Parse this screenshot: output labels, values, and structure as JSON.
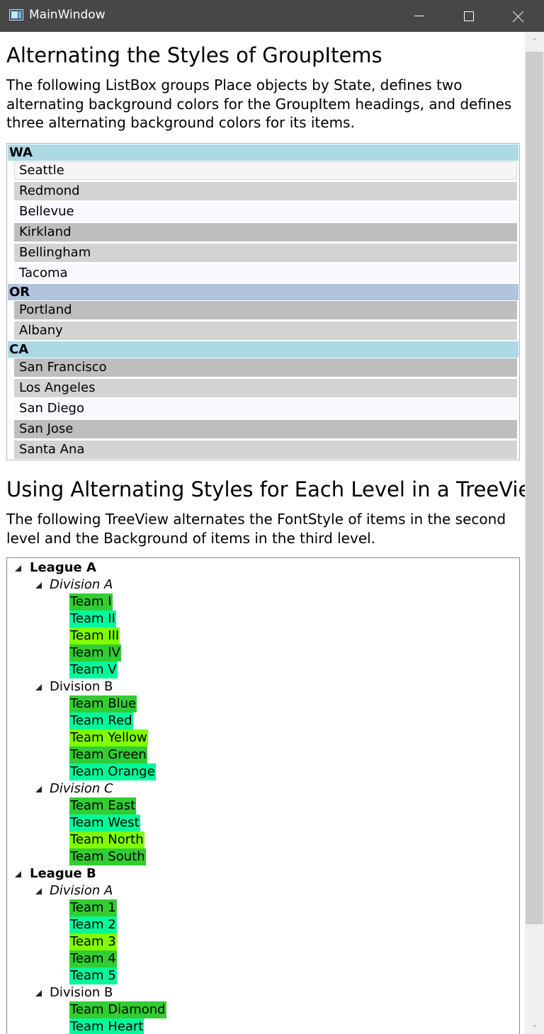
{
  "window": {
    "title": "MainWindow"
  },
  "section1": {
    "heading": "Alternating the Styles of GroupItems",
    "paragraph": "The following ListBox groups Place objects by State, defines two alternating background colors for the GroupItem headings, and defines three alternating background colors for its items."
  },
  "listbox": {
    "groups": [
      {
        "state": "WA",
        "color": "#ADD8E6",
        "items": [
          {
            "name": "Seattle",
            "color": "#F5F5F5",
            "selected": true
          },
          {
            "name": "Redmond",
            "color": "#D3D3D3"
          },
          {
            "name": "Bellevue",
            "color": "#F8F8FF"
          },
          {
            "name": "Kirkland",
            "color": "#BEBEBE"
          },
          {
            "name": "Bellingham",
            "color": "#D3D3D3"
          },
          {
            "name": "Tacoma",
            "color": "#F8F8FF"
          }
        ]
      },
      {
        "state": "OR",
        "color": "#B0C4DE",
        "items": [
          {
            "name": "Portland",
            "color": "#BEBEBE"
          },
          {
            "name": "Albany",
            "color": "#D3D3D3"
          }
        ]
      },
      {
        "state": "CA",
        "color": "#ADD8E6",
        "items": [
          {
            "name": "San Francisco",
            "color": "#BEBEBE"
          },
          {
            "name": "Los Angeles",
            "color": "#D3D3D3"
          },
          {
            "name": "San Diego",
            "color": "#F8F8FF"
          },
          {
            "name": "San Jose",
            "color": "#BEBEBE"
          },
          {
            "name": "Santa Ana",
            "color": "#D3D3D3"
          }
        ]
      }
    ]
  },
  "section2": {
    "heading": "Using Alternating Styles for Each Level in a TreeView",
    "paragraph": "The following TreeView alternates the FontStyle of items in the second level and the Background of items in the third level."
  },
  "treeview": {
    "team_colors": [
      "#32CD32",
      "#00FA9A",
      "#7FFF00"
    ],
    "leagues": [
      {
        "name": "League A",
        "divisions": [
          {
            "name": "Division A",
            "teams": [
              "Team I",
              "Team II",
              "Team III",
              "Team IV",
              "Team V"
            ]
          },
          {
            "name": "Division B",
            "teams": [
              "Team Blue",
              "Team Red",
              "Team Yellow",
              "Team Green",
              "Team Orange"
            ]
          },
          {
            "name": "Division C",
            "teams": [
              "Team East",
              "Team West",
              "Team North",
              "Team South"
            ]
          }
        ]
      },
      {
        "name": "League B",
        "divisions": [
          {
            "name": "Division A",
            "teams": [
              "Team 1",
              "Team 2",
              "Team 3",
              "Team 4",
              "Team 5"
            ]
          },
          {
            "name": "Division B",
            "teams": [
              "Team Diamond",
              "Team Heart"
            ]
          }
        ]
      }
    ]
  }
}
